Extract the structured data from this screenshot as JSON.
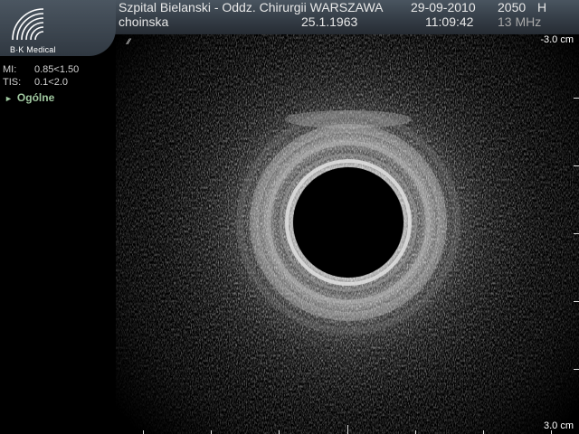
{
  "logo": {
    "icon": "bk-medical-arcs-icon",
    "text": "B·K Medical"
  },
  "header": {
    "hospital": "Szpital Bielanski - Oddz. Chirurgii WARSZAWA",
    "patient": "choinska",
    "birth_date": "25.1.1963",
    "date": "29-09-2010",
    "time": "11:09:42",
    "probe": "2050",
    "probe_suffix": "H",
    "frequency": "13 MHz"
  },
  "indices": [
    {
      "label": "MI:",
      "value": "0.85<1.50"
    },
    {
      "label": "TIS:",
      "value": "0.1<2.0"
    }
  ],
  "menu": {
    "label": "Ogólne",
    "icon": "triangle-right-icon"
  },
  "image": {
    "marker": "⁄⁄",
    "depth_top": "-3.0 cm",
    "depth_bottom": "3.0 cm"
  },
  "colors": {
    "header_bg": "#333b44",
    "menu_green": "#a0c8a0"
  }
}
